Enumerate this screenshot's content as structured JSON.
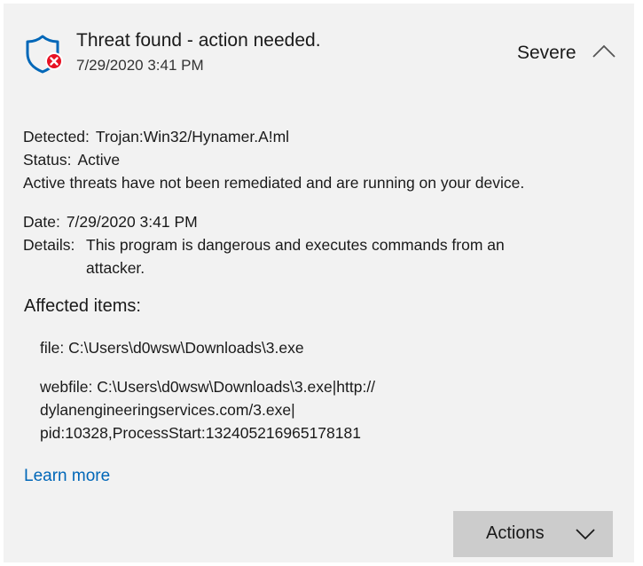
{
  "header": {
    "title": "Threat found - action needed.",
    "timestamp": "7/29/2020 3:41 PM",
    "severity": "Severe"
  },
  "detected": {
    "label": "Detected:",
    "value": "Trojan:Win32/Hynamer.A!ml"
  },
  "status": {
    "label": "Status:",
    "value": "Active"
  },
  "status_note": "Active threats have not been remediated and are running on your device.",
  "date": {
    "label": "Date:",
    "value": "7/29/2020 3:41 PM"
  },
  "details": {
    "label": "Details:",
    "line1": "This program is dangerous and executes commands from an",
    "line2": "attacker."
  },
  "affected": {
    "title": "Affected items:",
    "item1": "file: C:\\Users\\d0wsw\\Downloads\\3.exe",
    "item2_line1": "webfile: C:\\Users\\d0wsw\\Downloads\\3.exe|http://",
    "item2_line2": "dylanengineeringservices.com/3.exe|",
    "item2_line3": "pid:10328,ProcessStart:132405216965178181"
  },
  "learn_more": "Learn more",
  "actions_label": "Actions",
  "icons": {
    "shield": "shield-error-icon",
    "collapse": "chevron-up-icon",
    "actions": "chevron-down-icon"
  },
  "colors": {
    "accent_blue": "#0067b8",
    "error_red": "#e81123",
    "card_bg": "#f2f2f2",
    "button_bg": "#cccccc"
  }
}
